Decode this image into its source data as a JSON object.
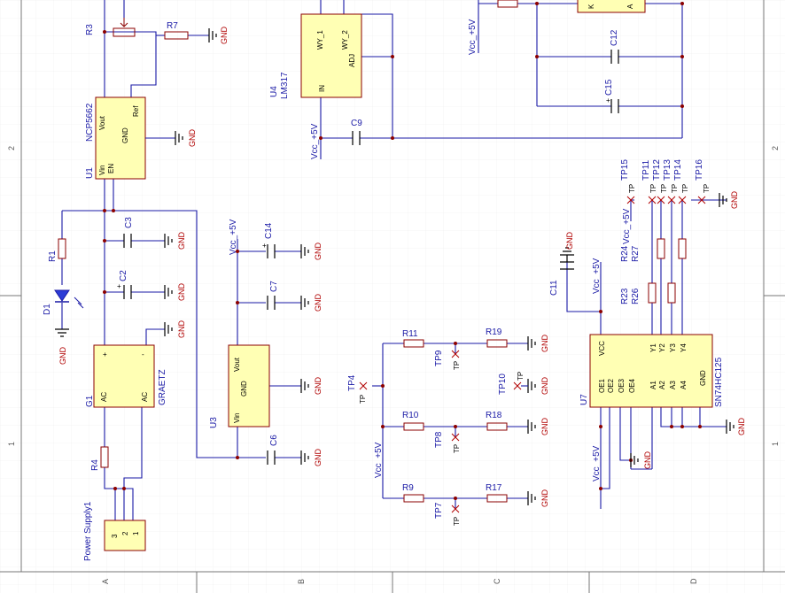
{
  "colors": {
    "wire": "#1a1aa6",
    "component": "#8b0000",
    "body": "#ffffb4",
    "ground": "#b00000",
    "grid": "#e6e6e6"
  },
  "frame": {
    "cols": [
      "A",
      "B",
      "C",
      "D"
    ],
    "rows": [
      "2",
      "1"
    ]
  },
  "labels": {
    "r3": "R3",
    "r7": "R7",
    "u1": "U1",
    "u1_part": "NCP5662",
    "u1_vout": "Vout",
    "u1_ref": "Ref",
    "u1_gnd": "GND",
    "u1_vin": "Vin",
    "u1_en": "EN",
    "r1": "R1",
    "d1": "D1",
    "c3": "C3",
    "c2": "C2",
    "g1": "G1",
    "g1_part": "GRAETZ",
    "g1_ac1": "AC",
    "g1_ac2": "AC",
    "r4": "R4",
    "ps": "Power Supply1",
    "u4": "U4",
    "u4_part": "LM317",
    "u4_wy1": "WY_1",
    "u4_wy2": "WY_2",
    "u4_adj": "ADJ",
    "u4_in": "IN",
    "c9": "C9",
    "vcc": "Vcc_+5V",
    "c12": "C12",
    "c15": "C15",
    "k": "K",
    "a": "A",
    "c14": "C14",
    "c7": "C7",
    "u3": "U3",
    "u3_vout": "Vout",
    "u3_gnd": "GND",
    "u3_vin": "Vin",
    "c6": "C6",
    "tp4": "TP4",
    "r11": "R11",
    "r19": "R19",
    "tp9": "TP9",
    "r10": "R10",
    "r18": "R18",
    "tp8": "TP8",
    "tp10": "TP10",
    "r9": "R9",
    "r17": "R17",
    "tp7": "TP7",
    "tp": "TP",
    "tp15": "TP15",
    "tp11": "TP11",
    "tp12": "TP12",
    "tp13": "TP13",
    "tp14": "TP14",
    "tp16": "TP16",
    "r24": "R24",
    "r27": "R27",
    "r23": "R23",
    "r26": "R26",
    "c11": "C11",
    "u7": "U7",
    "u7_part": "SN74HC125",
    "u7_vcc": "VCC",
    "u7_gnd": "GND",
    "u7_y1": "Y1",
    "u7_y2": "Y2",
    "u7_y3": "Y3",
    "u7_y4": "Y4",
    "u7_oe1": "OE1",
    "u7_oe2": "OE2",
    "u7_oe3": "OE3",
    "u7_oe4": "OE4",
    "u7_a1": "A1",
    "u7_a2": "A2",
    "u7_a3": "A3",
    "u7_a4": "A4",
    "gnd": "GND"
  }
}
